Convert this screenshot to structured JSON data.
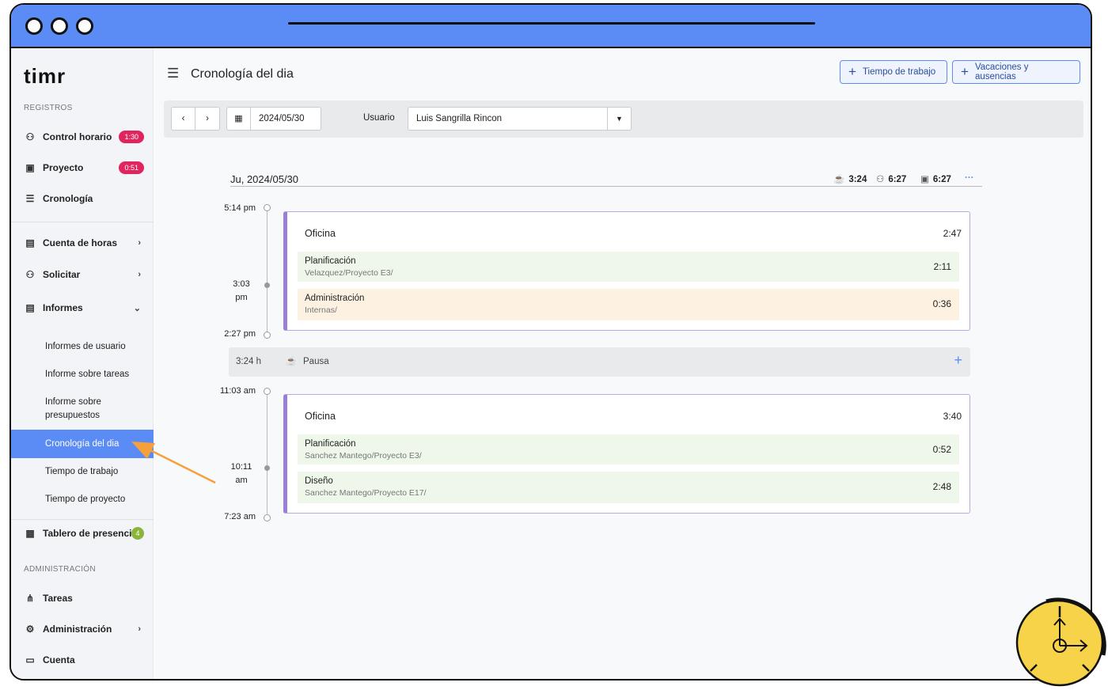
{
  "app": {
    "logo": "timr"
  },
  "sidebar": {
    "section_registros": "REGISTROS",
    "section_admin": "ADMINISTRACIÓN",
    "items": [
      {
        "label": "Control horario",
        "badge": "1:30"
      },
      {
        "label": "Proyecto",
        "badge": "0:51"
      },
      {
        "label": "Cronología"
      },
      {
        "label": "Cuenta de horas"
      },
      {
        "label": "Solicitar"
      },
      {
        "label": "Informes"
      },
      {
        "label": "Tablero de presencia",
        "badge": "4"
      },
      {
        "label": "Tareas"
      },
      {
        "label": "Administración"
      },
      {
        "label": "Cuenta"
      }
    ],
    "informes_sub": [
      "Informes de usuario",
      "Informe sobre tareas",
      "Informe sobre presupuestos",
      "Cronología del dia",
      "Tiempo de trabajo",
      "Tiempo de proyecto"
    ]
  },
  "header": {
    "title": "Cronología del dia",
    "btn_work": "Tiempo de trabajo",
    "btn_vac": "Vacaciones y ausencias"
  },
  "filter": {
    "date": "2024/05/30",
    "user_label": "Usuario",
    "user_value": "Luis Sangrilla Rincon"
  },
  "day": {
    "date_label": "Ju, 2024/05/30",
    "sum_pause": "3:24",
    "sum_work": "6:27",
    "sum_project": "6:27",
    "more": "···"
  },
  "timeline": {
    "t1": "5:14 pm",
    "t2": "3:03 pm",
    "t3": "2:27 pm",
    "t4": "11:03 am",
    "t5": "10:11 am",
    "t6": "7:23 am"
  },
  "blocks": [
    {
      "title": "Oficina",
      "total": "2:47",
      "tasks": [
        {
          "name": "Planificación",
          "path": "Velazquez/Proyecto E3/",
          "time": "2:11"
        },
        {
          "name": "Administración",
          "path": "Internas/",
          "time": "0:36"
        }
      ]
    },
    {
      "title": "Oficina",
      "total": "3:40",
      "tasks": [
        {
          "name": "Planificación",
          "path": "Sanchez Mantego/Proyecto E3/",
          "time": "0:52"
        },
        {
          "name": "Diseño",
          "path": "Sanchez Mantego/Proyecto E17/",
          "time": "2:48"
        }
      ]
    }
  ],
  "pause": {
    "duration": "3:24 h",
    "label": "Pausa",
    "add": "+"
  },
  "colors": {
    "accent": "#5b8cf5",
    "badge_red": "#e0245e",
    "badge_green": "#8bb43a",
    "block_border": "#9a7fd9",
    "arrow": "#f5a03a",
    "timer_icon": "#f7d34a"
  }
}
